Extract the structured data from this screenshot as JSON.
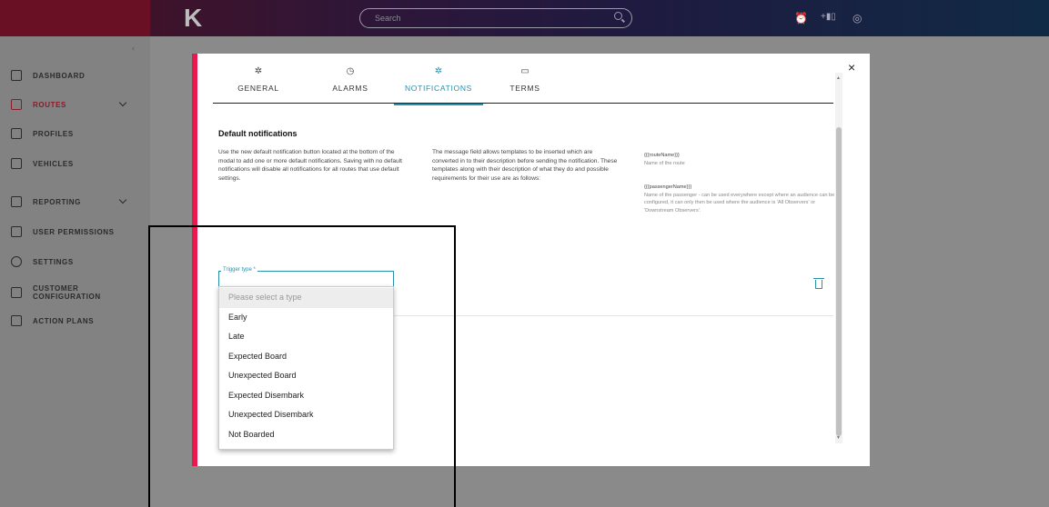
{
  "topbar": {
    "logo": "K",
    "search_placeholder": "Search",
    "icons": [
      "alarm-clock-icon",
      "add-bus-icon",
      "user-icon"
    ]
  },
  "sidebar": {
    "collapse_glyph": "‹",
    "items": [
      {
        "label": "DASHBOARD",
        "icon": "dashboard-icon",
        "active": false
      },
      {
        "label": "ROUTES",
        "icon": "routes-icon",
        "active": true,
        "expand": true
      },
      {
        "label": "PROFILES",
        "icon": "profiles-icon",
        "active": false
      },
      {
        "label": "VEHICLES",
        "icon": "bus-icon",
        "active": false
      },
      {
        "label": "REPORTING",
        "icon": "reporting-icon",
        "active": false,
        "expand": true
      },
      {
        "label": "USER PERMISSIONS",
        "icon": "lock-icon",
        "active": false
      },
      {
        "label": "SETTINGS",
        "icon": "gear-icon",
        "active": false
      },
      {
        "label": "CUSTOMER CONFIGURATION",
        "icon": "customer-config-icon",
        "active": false
      },
      {
        "label": "ACTION PLANS",
        "icon": "document-icon",
        "active": false
      }
    ]
  },
  "modal": {
    "close_glyph": "×",
    "tabs": [
      {
        "label": "GENERAL",
        "icon": "✲"
      },
      {
        "label": "ALARMS",
        "icon": "◷"
      },
      {
        "label": "NOTIFICATIONS",
        "icon": "✲"
      },
      {
        "label": "TERMS",
        "icon": "▭"
      }
    ],
    "section_title": "Default notifications",
    "para1": "Use the new default notification button located at the bottom of the modal to add one or more default notifications. Saving with no default notifications will disable all notifications for all routes that use default settings.",
    "para2": "The message field allows templates to be inserted which are converted in to their description before sending the notification. These templates along with their description of what they do and possible requirements for their use are as follows:",
    "templates": [
      {
        "key": "{{{routeName}}}",
        "desc": "Name of the route"
      },
      {
        "key": "{{{passengerName}}}",
        "desc": "Name of the passenger - can be used everywhere except where an audience can be configured, it can only then be used where the audience is 'All Observers' or 'Downstream Observers'."
      }
    ],
    "trigger_label": "Trigger type *",
    "dropdown_options": [
      "Please select a type",
      "Early",
      "Late",
      "Expected Board",
      "Unexpected Board",
      "Expected Disembark",
      "Unexpected Disembark",
      "Not Boarded"
    ]
  },
  "colors": {
    "accent": "#2a8fa8",
    "brand": "#e8194e",
    "active_nav": "#8b1a2a"
  }
}
